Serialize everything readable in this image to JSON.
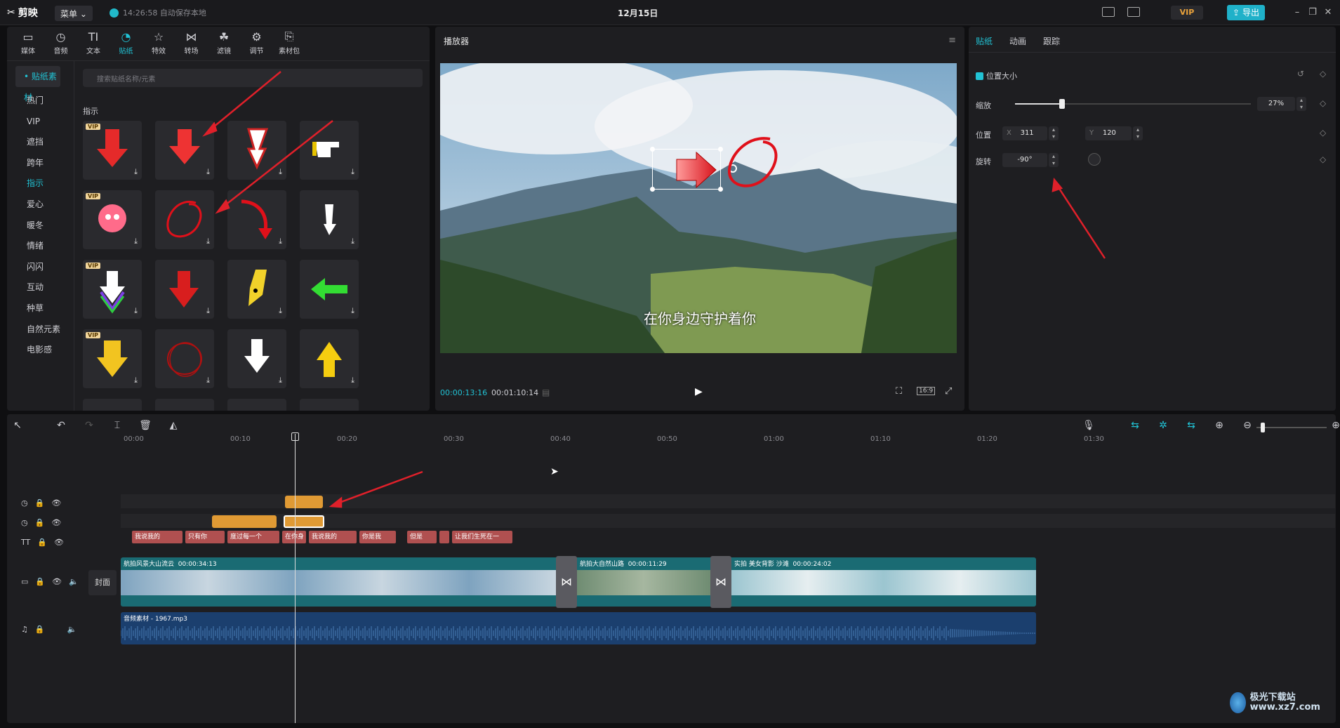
{
  "app": {
    "name": "剪映",
    "menu_label": "菜单",
    "autosave": "14:26:58 自动保存本地",
    "doc_title": "12月15日",
    "vip_label": "VIP",
    "export_label": "导出"
  },
  "toolbar": {
    "tools": [
      "媒体",
      "音频",
      "文本",
      "贴纸",
      "特效",
      "转场",
      "滤镜",
      "调节",
      "素材包"
    ],
    "active": "贴纸"
  },
  "sidebar": {
    "head": "• 贴纸素材",
    "items": [
      "热门",
      "VIP",
      "遮挡",
      "跨年",
      "指示",
      "爱心",
      "暖冬",
      "情绪",
      "闪闪",
      "互动",
      "种草",
      "自然元素",
      "电影感"
    ],
    "active": "指示"
  },
  "search": {
    "placeholder": "搜索贴纸名称/元素"
  },
  "section_title": "指示",
  "stickers": [
    {
      "name": "red-3d-arrow-down",
      "vip": true
    },
    {
      "name": "red-arrow-down",
      "vip": false
    },
    {
      "name": "red-white-arrow-down",
      "vip": false
    },
    {
      "name": "pointing-hand",
      "vip": false
    },
    {
      "name": "pink-monster",
      "vip": true
    },
    {
      "name": "red-circle",
      "vip": false
    },
    {
      "name": "red-curved-arrow",
      "vip": false
    },
    {
      "name": "white-arrow-down",
      "vip": false
    },
    {
      "name": "rainbow-arrow-down",
      "vip": true
    },
    {
      "name": "red-bold-arrow-down",
      "vip": false
    },
    {
      "name": "yellow-face-arrow",
      "vip": false
    },
    {
      "name": "green-arrow-left",
      "vip": false
    },
    {
      "name": "yellow-3d-arrow-down",
      "vip": true
    },
    {
      "name": "red-scribble-circle",
      "vip": false
    },
    {
      "name": "white-smile-arrow",
      "vip": false
    },
    {
      "name": "yellow-arrow-up",
      "vip": false
    }
  ],
  "vip_tag": "VIP",
  "player": {
    "title": "播放器",
    "timecode_current": "00:00:13:16",
    "timecode_total": "00:01:10:14",
    "subtitle": "在你身边守护着你",
    "ratio": "16:9"
  },
  "props": {
    "tabs": [
      "贴纸",
      "动画",
      "跟踪"
    ],
    "active_tab": "贴纸",
    "section": "位置大小",
    "scale_label": "缩放",
    "scale_value": "27%",
    "scale_fraction": 0.27,
    "position_label": "位置",
    "x_label": "X",
    "x_value": "311",
    "y_label": "Y",
    "y_value": "120",
    "rotate_label": "旋转",
    "rotate_value": "-90°"
  },
  "timeline": {
    "ruler": [
      "00:00",
      "00:10",
      "00:20",
      "00:30",
      "00:40",
      "00:50",
      "01:00",
      "01:10",
      "01:20",
      "01:30"
    ],
    "cover_label": "封面",
    "text_clips": [
      "我说我的",
      "只有你",
      "度过每一个",
      "在你身",
      "我说我的",
      "你是我",
      "但是",
      "",
      "让我们生死在一"
    ],
    "video_clips": [
      {
        "title": "航拍风景大山流云",
        "duration": "00:00:34:13"
      },
      {
        "title": "航拍大自然山路",
        "duration": "00:00:11:29"
      },
      {
        "title": "实拍 美女背影 沙滩",
        "duration": "00:00:24:02"
      }
    ],
    "audio_clip": "音频素材 - 1967.mp3"
  },
  "watermark": "极光下载站 www.xz7.com",
  "colors": {
    "accent": "#21c2d4",
    "sticker_clip": "#e09a34",
    "text_clip": "#b05050",
    "video_track": "#1a6b73",
    "audio_track": "#1b3f6e",
    "annotation": "#e0202a"
  }
}
